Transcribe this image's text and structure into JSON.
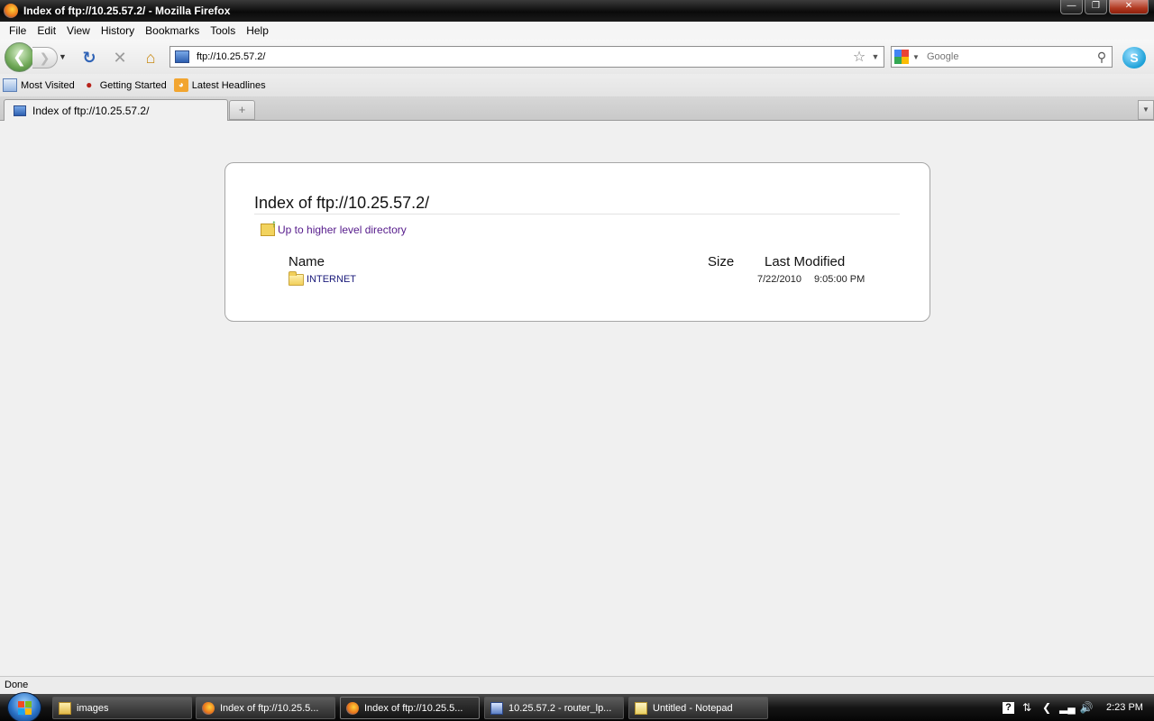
{
  "window": {
    "title": "Index of ftp://10.25.57.2/ - Mozilla Firefox"
  },
  "menu": {
    "items": [
      {
        "label": "File"
      },
      {
        "label": "Edit"
      },
      {
        "label": "View"
      },
      {
        "label": "History"
      },
      {
        "label": "Bookmarks"
      },
      {
        "label": "Tools"
      },
      {
        "label": "Help"
      }
    ]
  },
  "navbar": {
    "url": "ftp://10.25.57.2/",
    "search_placeholder": "Google"
  },
  "bookmarks": {
    "items": [
      {
        "label": "Most Visited",
        "icon": "most-visited-icon"
      },
      {
        "label": "Getting Started",
        "icon": "getting-started-icon"
      },
      {
        "label": "Latest Headlines",
        "icon": "rss-icon"
      }
    ]
  },
  "tabs": [
    {
      "label": "Index of ftp://10.25.57.2/",
      "active": true
    }
  ],
  "page": {
    "title": "Index of ftp://10.25.57.2/",
    "up_link": "Up to higher level directory",
    "columns": {
      "name": "Name",
      "size": "Size",
      "modified": "Last Modified"
    },
    "rows": [
      {
        "name": "INTERNET",
        "size": "",
        "date": "7/22/2010",
        "time": "9:05:00 PM",
        "type": "folder"
      }
    ]
  },
  "status": {
    "text": "Done"
  },
  "taskbar": {
    "tasks": [
      {
        "label": "images",
        "icon": "folder"
      },
      {
        "label": "Index of ftp://10.25.5...",
        "icon": "firefox"
      },
      {
        "label": "Index of ftp://10.25.5...",
        "icon": "firefox",
        "active": true
      },
      {
        "label": "10.25.57.2 - router_lp...",
        "icon": "putty"
      },
      {
        "label": "Untitled - Notepad",
        "icon": "notepad"
      }
    ],
    "clock": "2:23 PM"
  }
}
